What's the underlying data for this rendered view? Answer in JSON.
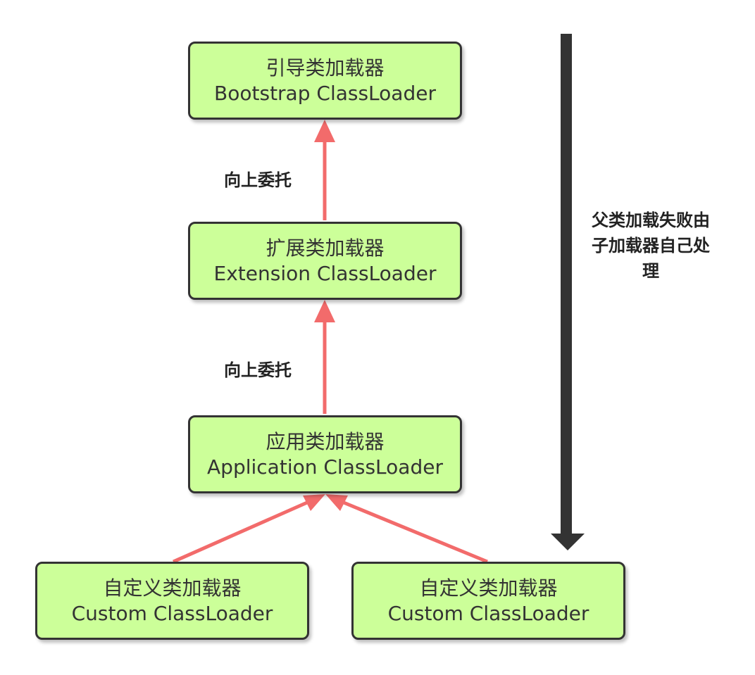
{
  "nodes": {
    "bootstrap": {
      "zh": "引导类加载器",
      "en": "Bootstrap ClassLoader"
    },
    "extension": {
      "zh": "扩展类加载器",
      "en": "Extension ClassLoader"
    },
    "application": {
      "zh": "应用类加载器",
      "en": "Application ClassLoader"
    },
    "custom_1": {
      "zh": "自定义类加载器",
      "en": "Custom ClassLoader"
    },
    "custom_2": {
      "zh": "自定义类加载器",
      "en": "Custom ClassLoader"
    }
  },
  "edges": {
    "delegate_up_1": "向上委托",
    "delegate_up_2": "向上委托"
  },
  "side_note": "父类加载失败由子加载器自己处理",
  "colors": {
    "node_fill": "#ccff99",
    "node_border": "#333333",
    "delegate_arrow": "#f26b6b",
    "fallback_arrow": "#333333"
  }
}
